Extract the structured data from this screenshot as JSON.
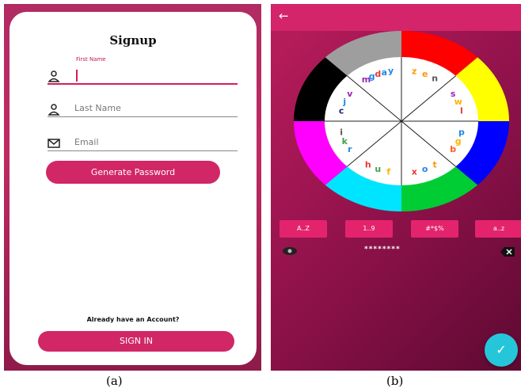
{
  "signup": {
    "title": "Signup",
    "first_name_floating_label": "First Name",
    "last_name_placeholder": "Last Name",
    "email_placeholder": "Email",
    "generate_button": "Generate Password",
    "already_account": "Already have an Account?",
    "signin_button": "SIGN IN"
  },
  "captions": {
    "a": "(a)",
    "b": "(b)"
  },
  "wheel": {
    "outer_colors": [
      "#ff0000",
      "#ffff00",
      "#0000ff",
      "#00cc33",
      "#00e5ff",
      "#ff00ff",
      "#000000",
      "#9e9e9e"
    ],
    "sectors": [
      {
        "letters": [
          {
            "ch": "z",
            "color": "#ff9800"
          },
          {
            "ch": "e",
            "color": "#ff9800"
          },
          {
            "ch": "n",
            "color": "#555555"
          }
        ]
      },
      {
        "letters": [
          {
            "ch": "s",
            "color": "#9c27b0"
          },
          {
            "ch": "w",
            "color": "#ffb300"
          },
          {
            "ch": "l",
            "color": "#e53935"
          }
        ]
      },
      {
        "letters": [
          {
            "ch": "p",
            "color": "#1e88e5"
          },
          {
            "ch": "g",
            "color": "#ffb300"
          },
          {
            "ch": "b",
            "color": "#ff5722"
          }
        ]
      },
      {
        "letters": [
          {
            "ch": "t",
            "color": "#ff9800"
          },
          {
            "ch": "o",
            "color": "#1e88e5"
          },
          {
            "ch": "x",
            "color": "#e53935"
          }
        ]
      },
      {
        "letters": [
          {
            "ch": "f",
            "color": "#ffb300"
          },
          {
            "ch": "u",
            "color": "#43a047"
          },
          {
            "ch": "h",
            "color": "#e53935"
          }
        ]
      },
      {
        "letters": [
          {
            "ch": "r",
            "color": "#1e88e5"
          },
          {
            "ch": "k",
            "color": "#43a047"
          },
          {
            "ch": "i",
            "color": "#6d4c41"
          }
        ]
      },
      {
        "letters": [
          {
            "ch": "c",
            "color": "#1a237e"
          },
          {
            "ch": "j",
            "color": "#1e88e5"
          },
          {
            "ch": "v",
            "color": "#9c27b0"
          }
        ]
      },
      {
        "letters": [
          {
            "ch": "m",
            "color": "#9c27b0"
          },
          {
            "ch": "g",
            "color": "#1e88e5"
          },
          {
            "ch": "d",
            "color": "#e53935"
          },
          {
            "ch": "a",
            "color": "#1e88e5"
          },
          {
            "ch": "y",
            "color": "#1e88e5"
          }
        ]
      }
    ]
  },
  "buttons": {
    "upper": "A..Z",
    "digits": "1..9",
    "symbols": "#*$%",
    "lower": "a..z"
  },
  "password_masked": "********",
  "icons": {
    "back": "back-arrow-icon",
    "eye": "eye-icon",
    "backspace": "backspace-icon",
    "check": "check-icon"
  }
}
